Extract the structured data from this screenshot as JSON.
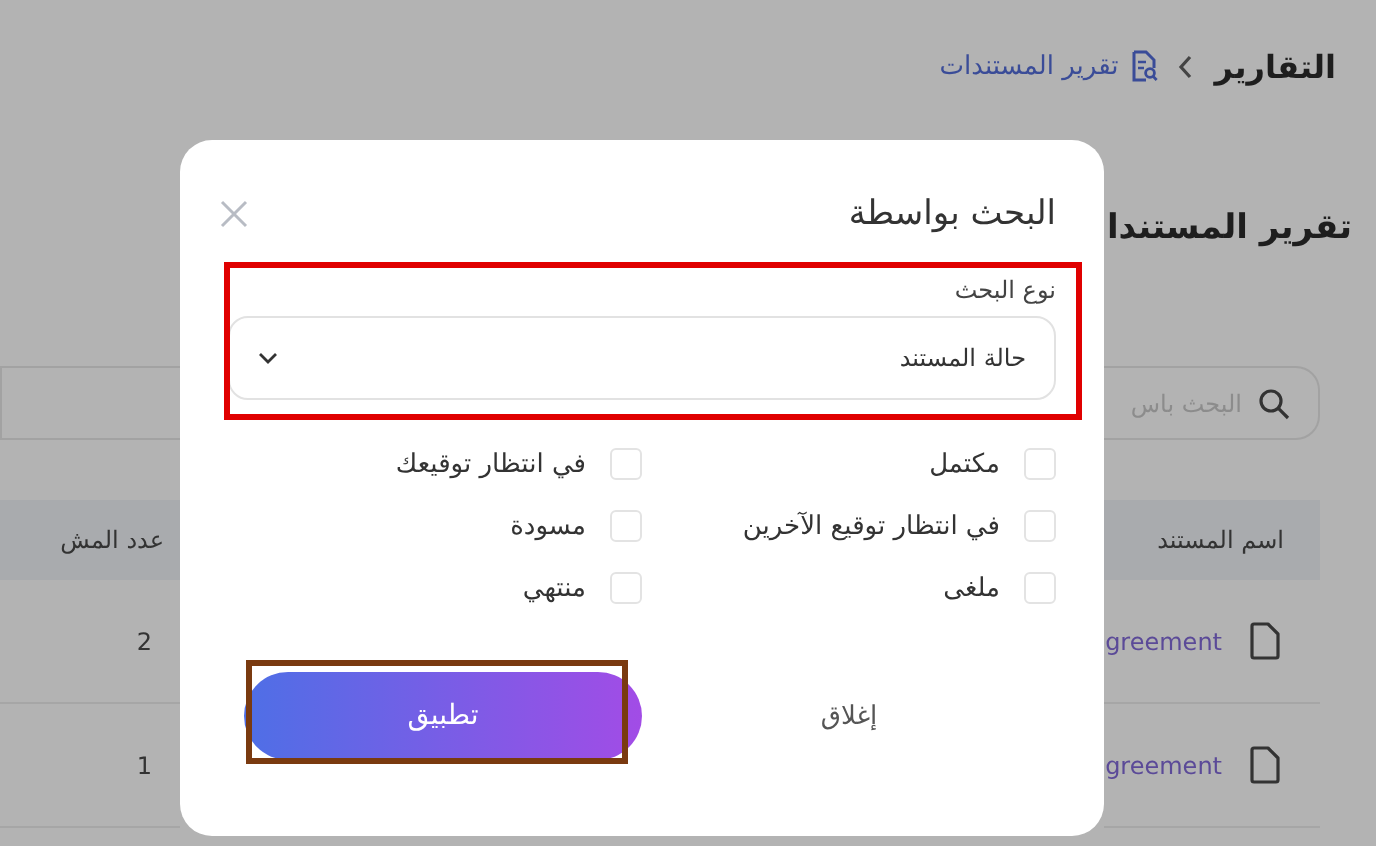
{
  "breadcrumb": {
    "parent": "التقارير",
    "current": "تقرير المستندات"
  },
  "page": {
    "title": "تقرير المستندا",
    "search": {
      "placeholder": "البحث باس"
    },
    "table": {
      "columns": [
        "اسم المستند",
        "عدد المش"
      ],
      "rows": [
        {
          "document": "greement",
          "count": "2"
        },
        {
          "document": "greement",
          "count": "1"
        }
      ]
    }
  },
  "dialog": {
    "title": "البحث بواسطة",
    "search_type": {
      "label": "نوع البحث",
      "value": "حالة المستند"
    },
    "statuses": [
      {
        "label": "مكتمل",
        "checked": false
      },
      {
        "label": "في انتظار توقيعك",
        "checked": false
      },
      {
        "label": "في انتظار توقيع الآخرين",
        "checked": false
      },
      {
        "label": "مسودة",
        "checked": false
      },
      {
        "label": "ملغى",
        "checked": false
      },
      {
        "label": "منتهي",
        "checked": false
      }
    ],
    "buttons": {
      "close": "إغلاق",
      "apply": "تطبيق"
    }
  },
  "highlights": [
    {
      "kind": "select",
      "color": "#e00000"
    },
    {
      "kind": "apply",
      "color": "#7a3a10"
    }
  ]
}
